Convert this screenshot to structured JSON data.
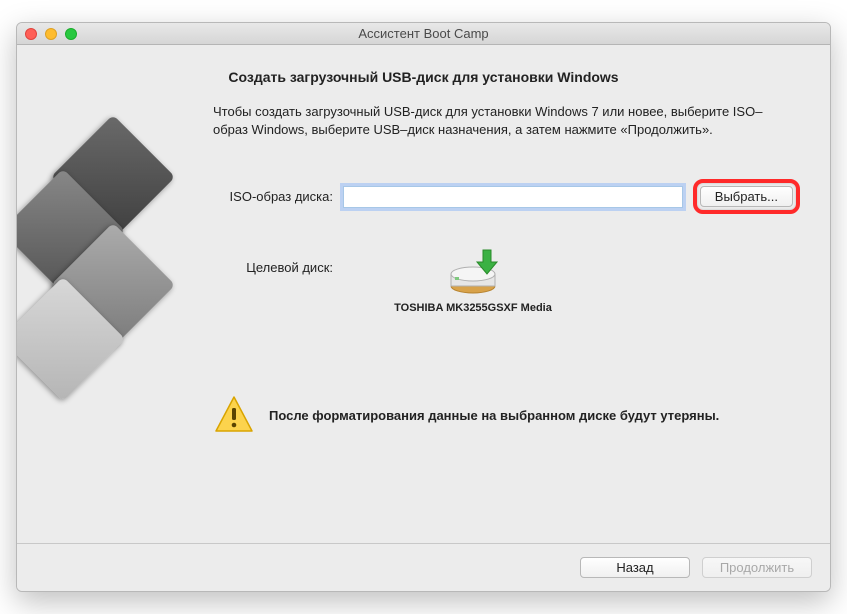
{
  "window": {
    "title": "Ассистент Boot Camp"
  },
  "page": {
    "title": "Создать загрузочный USB-диск для установки Windows",
    "instruction": "Чтобы создать загрузочный USB-диск для установки Windows 7 или новее, выберите ISO–образ Windows, выберите USB–диск назначения, а затем нажмите «Продолжить»."
  },
  "form": {
    "iso_label": "ISO-образ диска:",
    "iso_value": "",
    "choose_label": "Выбрать...",
    "target_label": "Целевой диск:",
    "target_disk_name": "TOSHIBA MK3255GSXF Media"
  },
  "warning": {
    "text": "После форматирования данные на выбранном диске будут утеряны."
  },
  "footer": {
    "back_label": "Назад",
    "continue_label": "Продолжить"
  }
}
